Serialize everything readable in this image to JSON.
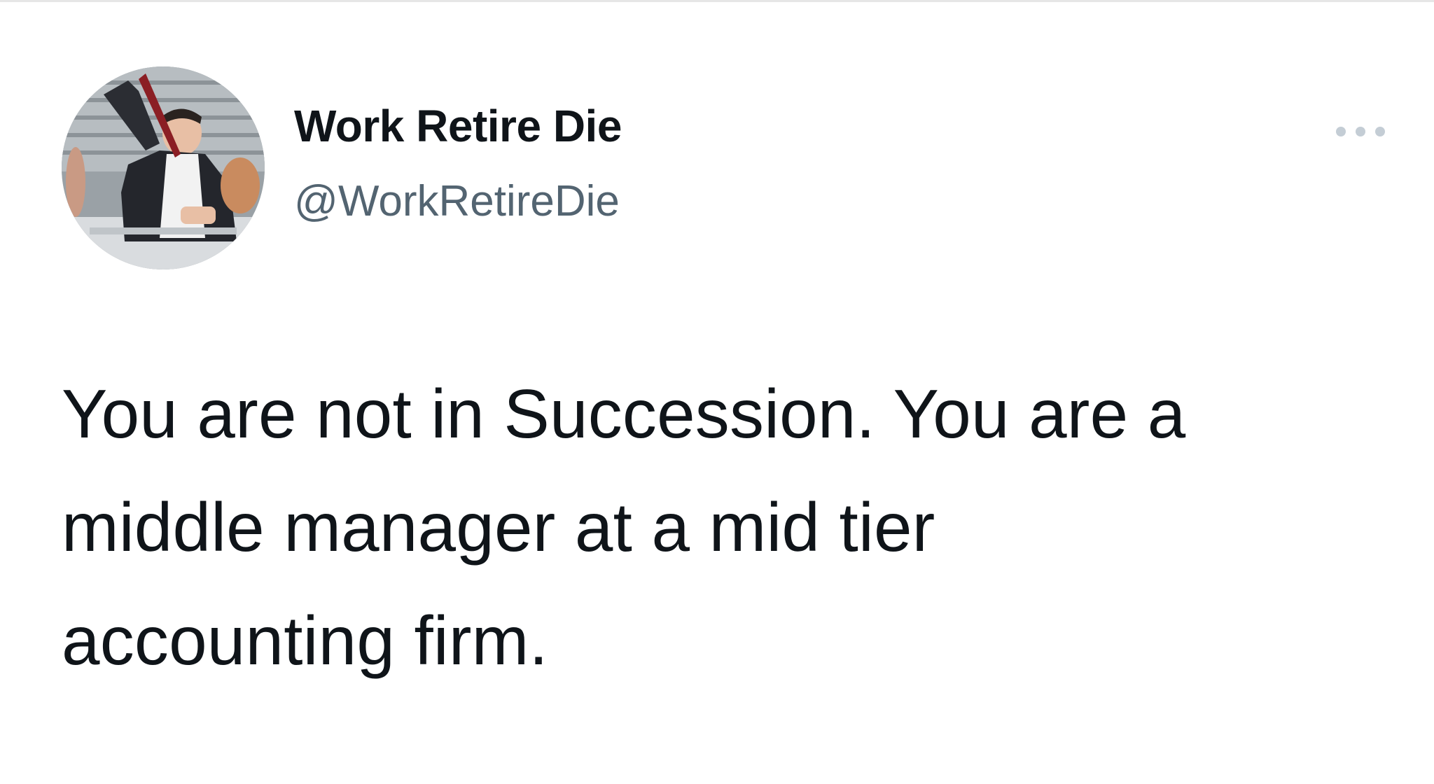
{
  "tweet": {
    "author": {
      "display_name": "Work Retire Die",
      "handle": "@WorkRetireDie",
      "avatar_icon": "avatar-photo"
    },
    "more_icon": "more-options-icon",
    "text_lines": [
      "You are not in Succession. You are a",
      "middle manager at a mid tier",
      "accounting firm."
    ]
  },
  "colors": {
    "text": "#0f1419",
    "secondary_text": "#536471",
    "background": "#ffffff",
    "icon": "#c4cdd5"
  }
}
